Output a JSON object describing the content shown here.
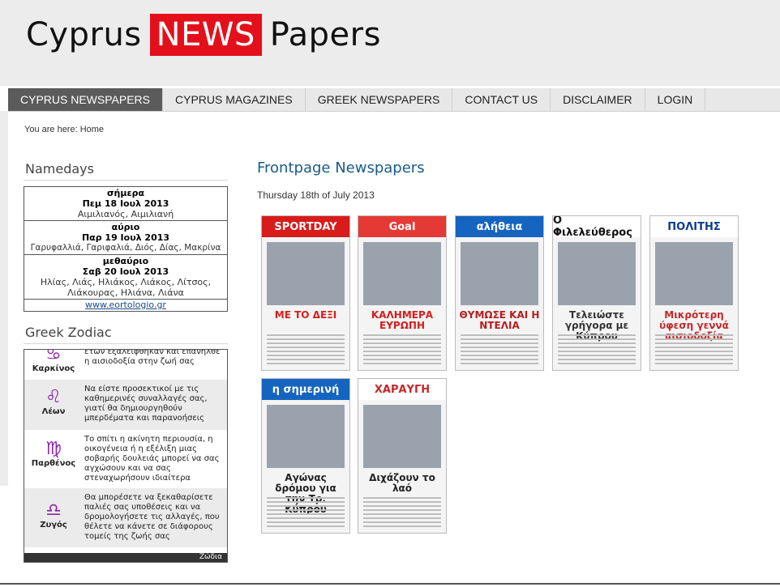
{
  "header": {
    "logo_left": "Cyprus",
    "logo_mid": "NEWS",
    "logo_right": "Papers"
  },
  "nav": {
    "items": [
      {
        "label": "CYPRUS NEWSPAPERS"
      },
      {
        "label": "CYPRUS MAGAZINES"
      },
      {
        "label": "GREEK NEWSPAPERS"
      },
      {
        "label": "CONTACT US"
      },
      {
        "label": "DISCLAIMER"
      },
      {
        "label": "LOGIN"
      }
    ]
  },
  "breadcrumb": "You are here: Home",
  "namedays": {
    "title": "Namedays",
    "days": [
      {
        "day": "σήμερα",
        "date": "Πεμ 18 Ιουλ 2013",
        "names": "Αιμιλιανός, Αιμιλιανή"
      },
      {
        "day": "αύριο",
        "date": "Παρ 19 Ιουλ 2013",
        "names": "Γαρυφαλλιά, Γαριφαλιά, Διός, Δίας, Μακρίνα"
      },
      {
        "day": "μεθαύριο",
        "date": "Σαβ 20 Ιουλ 2013",
        "names": "Ηλίας, Λιάς, Ηλιάκος, Λιάκος, Λίτσος, Λιάκουρας, Ηλιάνα, Λιάνα"
      }
    ],
    "link": "www.eortologio.gr"
  },
  "zodiac": {
    "title": "Greek Zodiac",
    "signs": [
      {
        "name": "Καρκίνος",
        "symbol": "♋",
        "text": "ετών εξαλειφθήκαν και επανηλθε η αισιοδοξία στην ζωή σας"
      },
      {
        "name": "Λέων",
        "symbol": "♌",
        "text": "Να είστε προσεκτικοί με τις καθημερινές συναλλαγές σας, γιατί θα δημιουργηθούν μπερδέματα και παρανοήσεις"
      },
      {
        "name": "Παρθένος",
        "symbol": "♍",
        "text": "Το σπίτι η ακίνητη περιουσία, η οικογένεια ή η εξέλιξη μιας σοβαρής δουλειάς μπορεί να σας αγχώσουν και να σας στεναχωρήσουν ιδιαίτερα"
      },
      {
        "name": "Ζυγός",
        "symbol": "♎",
        "text": "Θα μπορέσετε να ξεκαθαρίσετε παλιές σας υποθέσεις και να δρομολογήσετε τις αλλαγές, που θέλετε να κάνετε σε διάφορους τομείς της ζωής σας"
      }
    ],
    "footer": "Ζώδια"
  },
  "main": {
    "title": "Frontpage Newspapers",
    "date": "Thursday 18th of July 2013",
    "papers": [
      {
        "masthead": "SPORTDAY",
        "headline": "ΜΕ ΤΟ ΔΕΞΙ",
        "mast_bg": "#d81b1b",
        "mast_fg": "#ffffff",
        "head_color": "#d81b1b"
      },
      {
        "masthead": "Goal",
        "headline": "ΚΑΛΗΜΕΡΑ ΕΥΡΩΠΗ",
        "mast_bg": "#e53935",
        "mast_fg": "#ffffff",
        "head_color": "#d81b1b"
      },
      {
        "masthead": "αλήθεια",
        "headline": "ΘΥΜΩΣΕ ΚΑΙ Η ΝΤΕΛΙΑ",
        "mast_bg": "#1565c0",
        "mast_fg": "#ffffff",
        "head_color": "#b71c1c"
      },
      {
        "masthead": "Ο Φιλελεύθερος",
        "headline": "Τελειώστε γρήγορα με Κύπρου",
        "mast_bg": "#ffffff",
        "mast_fg": "#111111",
        "head_color": "#333333"
      },
      {
        "masthead": "ΠΟΛΙΤΗΣ",
        "headline": "Μικρότερη ύφεση γεννά αισιοδοξία",
        "mast_bg": "#ffffff",
        "mast_fg": "#0d3c8c",
        "head_color": "#c62828"
      },
      {
        "masthead": "η σημερινή",
        "headline": "Αγώνας δρόμου για την Τρ. Κύπρου",
        "mast_bg": "#1565c0",
        "mast_fg": "#ffffff",
        "head_color": "#222222"
      },
      {
        "masthead": "ΧΑΡΑΥΓΗ",
        "headline": "Διχάζουν το λαό",
        "mast_bg": "#ffffff",
        "mast_fg": "#c62828",
        "head_color": "#222222"
      }
    ]
  }
}
